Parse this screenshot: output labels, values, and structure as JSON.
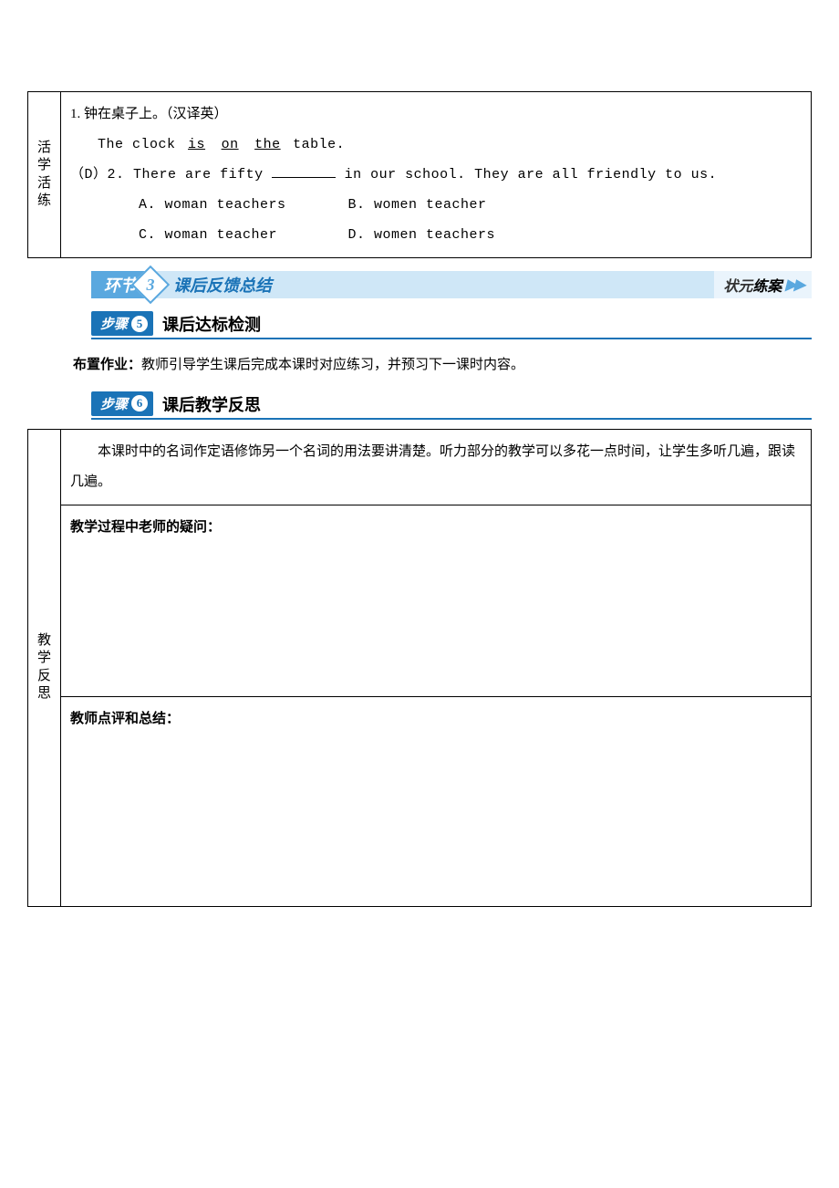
{
  "table1": {
    "rowLabel": "活学活练",
    "q1_num": "1.",
    "q1_zh": "钟在桌子上。（汉译英）",
    "q1_en_prefix": "The clock",
    "q1_blank1": "is",
    "q1_blank2": "on",
    "q1_blank3": "the",
    "q1_en_suffix": "table.",
    "q2_prefix": "（",
    "q2_answer": "D",
    "q2_mid": "）2. There are fifty",
    "q2_suffix": "in our school. They are all friendly to us.",
    "q2_optA": "A. woman teachers",
    "q2_optB": "B. women teacher",
    "q2_optC": "C. woman teacher",
    "q2_optD": "D. women teachers"
  },
  "section3": {
    "label": "环节",
    "num": "3",
    "title": "课后反馈总结",
    "right1": "状元",
    "right2": "练案",
    "arrows": "▶▶"
  },
  "step5": {
    "label": "步骤",
    "num": "5",
    "title": "课后达标检测"
  },
  "assign": {
    "label": "布置作业：",
    "text": "教师引导学生课后完成本课时对应练习，并预习下一课时内容。"
  },
  "step6": {
    "label": "步骤",
    "num": "6",
    "title": "课后教学反思"
  },
  "table2": {
    "rowLabel": "教学反思",
    "para": "本课时中的名词作定语修饰另一个名词的用法要讲清楚。听力部分的教学可以多花一点时间，让学生多听几遍，跟读几遍。",
    "sub1": "教学过程中老师的疑问：",
    "sub2": "教师点评和总结："
  }
}
